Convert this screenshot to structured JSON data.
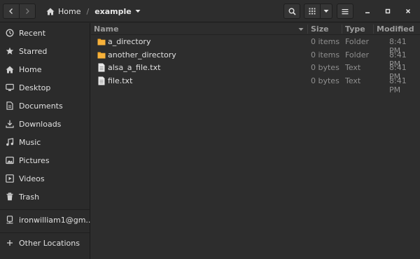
{
  "header": {
    "breadcrumbs": [
      {
        "label": "Home"
      },
      {
        "label": "example"
      }
    ]
  },
  "sidebar": {
    "items": [
      {
        "label": "Recent",
        "icon": "clock-icon"
      },
      {
        "label": "Starred",
        "icon": "star-icon"
      },
      {
        "label": "Home",
        "icon": "home-icon"
      },
      {
        "label": "Desktop",
        "icon": "desktop-icon"
      },
      {
        "label": "Documents",
        "icon": "document-icon"
      },
      {
        "label": "Downloads",
        "icon": "download-icon"
      },
      {
        "label": "Music",
        "icon": "music-icon"
      },
      {
        "label": "Pictures",
        "icon": "picture-icon"
      },
      {
        "label": "Videos",
        "icon": "video-icon"
      },
      {
        "label": "Trash",
        "icon": "trash-icon"
      }
    ],
    "mounts": [
      {
        "label": "ironwilliam1@gm...",
        "icon": "drive-icon"
      }
    ],
    "other": {
      "label": "Other Locations",
      "icon": "plus-icon"
    }
  },
  "list": {
    "columns": {
      "name": "Name",
      "size": "Size",
      "type": "Type",
      "modified": "Modified"
    },
    "rows": [
      {
        "name": "a_directory",
        "size": "0 items",
        "type": "Folder",
        "modified": "8:41 PM",
        "icon": "folder-icon"
      },
      {
        "name": "another_directory",
        "size": "0 items",
        "type": "Folder",
        "modified": "8:41 PM",
        "icon": "folder-icon"
      },
      {
        "name": "alsa_a_file.txt",
        "size": "0 bytes",
        "type": "Text",
        "modified": "8:41 PM",
        "icon": "text-file-icon"
      },
      {
        "name": "file.txt",
        "size": "0 bytes",
        "type": "Text",
        "modified": "8:41 PM",
        "icon": "text-file-icon"
      }
    ]
  },
  "colors": {
    "folder": "#f5a623",
    "background": "#2d2d2d",
    "sidebar": "#2b2b2b"
  }
}
